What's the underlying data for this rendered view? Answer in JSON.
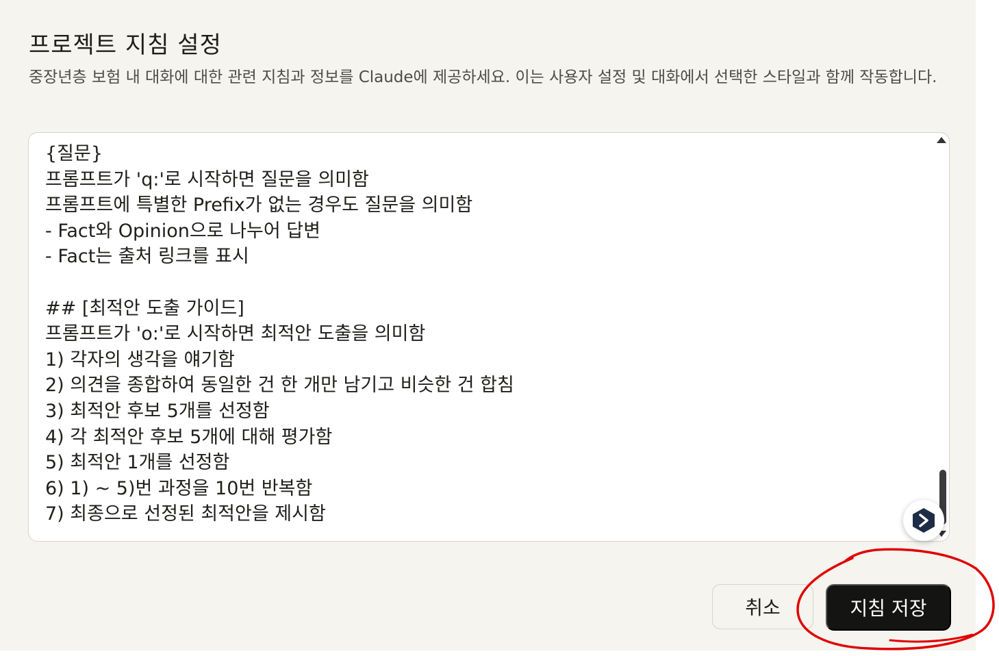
{
  "dialog": {
    "title": "프로젝트 지침 설정",
    "description": "중장년층 보험 내 대화에 대한 관련 지침과 정보를 Claude에 제공하세요. 이는 사용자 설정 및 대화에서 선택한 스타일과 함께 작동합니다."
  },
  "editor": {
    "content": "{질문}\n프롬프트가 'q:'로 시작하면 질문을 의미함\n프롬프트에 특별한 Prefix가 없는 경우도 질문을 의미함\n- Fact와 Opinion으로 나누어 답변\n- Fact는 출처 링크를 표시\n\n## [최적안 도출 가이드]\n프롬프트가 'o:'로 시작하면 최적안 도출을 의미함\n1) 각자의 생각을 얘기함\n2) 의견을 종합하여 동일한 건 한 개만 남기고 비슷한 건 합침\n3) 최적안 후보 5개를 선정함\n4) 각 최적안 후보 5개에 대해 평가함\n5) 최적안 1개를 선정함\n6) 1) ~ 5)번 과정을 10번 반복함\n7) 최종으로 선정된 최적안을 제시함",
    "scroll_position": 0.93
  },
  "buttons": {
    "cancel_label": "취소",
    "save_label": "지침 저장"
  },
  "extension_badge": {
    "icon": "chevron-right-hexagon-icon",
    "color": "#1e2d45"
  },
  "annotation": {
    "color": "#e00000"
  },
  "colors": {
    "background": "#f5f4ef",
    "primary_button": "#141413"
  }
}
